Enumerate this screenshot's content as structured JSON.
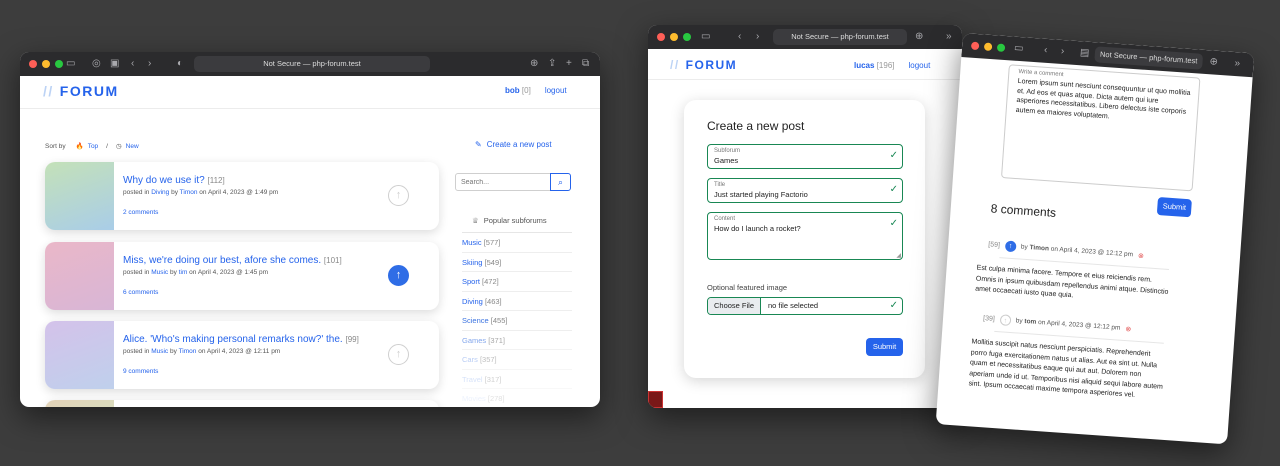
{
  "window1": {
    "address": "Not Secure — php-forum.test",
    "logo": "FORUM",
    "nav": {
      "user": "bob",
      "points": "[0]",
      "logout": "logout"
    },
    "sort": {
      "label": "Sort by",
      "top": "Top",
      "sep": "/",
      "new": "New"
    },
    "create_link": "Create a new post",
    "search_placeholder": "Search...",
    "popular_heading": "Popular subforums",
    "posts": [
      {
        "title": "Why do we use it?",
        "score": "[112]",
        "pre": "posted in",
        "forum": "Diving",
        "by": "by",
        "author": "Timon",
        "date": "on April 4, 2023 @ 1:49 pm",
        "comments": "2 comments",
        "voted": false
      },
      {
        "title": "Miss, we're doing our best, afore she comes.",
        "score": "[101]",
        "pre": "posted in",
        "forum": "Music",
        "by": "by",
        "author": "tim",
        "date": "on April 4, 2023 @ 1:45 pm",
        "comments": "6 comments",
        "voted": true
      },
      {
        "title": "Alice. 'Who's making personal remarks now?' the.",
        "score": "[99]",
        "pre": "posted in",
        "forum": "Music",
        "by": "by",
        "author": "Timon",
        "date": "on April 4, 2023 @ 12:11 pm",
        "comments": "9 comments",
        "voted": false
      }
    ],
    "subforums": [
      {
        "name": "Music",
        "count": "[577]"
      },
      {
        "name": "Skiing",
        "count": "[549]"
      },
      {
        "name": "Sport",
        "count": "[472]"
      },
      {
        "name": "Diving",
        "count": "[463]"
      },
      {
        "name": "Science",
        "count": "[455]"
      },
      {
        "name": "Games",
        "count": "[371]"
      },
      {
        "name": "Cars",
        "count": "[357]"
      },
      {
        "name": "Travel",
        "count": "[317]"
      },
      {
        "name": "Movies",
        "count": "[278]"
      }
    ]
  },
  "window2": {
    "address": "Not Secure — php-forum.test",
    "logo": "FORUM",
    "nav": {
      "user": "lucas",
      "points": "[196]",
      "logout": "logout"
    },
    "card_title": "Create a new post",
    "subforum": {
      "label": "Subforum",
      "value": "Games"
    },
    "title": {
      "label": "Title",
      "value": "Just started playing Factorio"
    },
    "content": {
      "label": "Content",
      "value": "How do I launch a rocket?"
    },
    "image_label": "Optional featured image",
    "choose_file": "Choose File",
    "no_file": "no file selected",
    "submit": "Submit"
  },
  "window3": {
    "address": "Not Secure — php-forum.test",
    "write_label": "Write a comment",
    "write_text": "Lorem ipsum sunt nesciunt consequuntur ut quo mollitia et. Ad eos et quas atque. Dicta autem qui iure asperiores necessitatibus. Libero delectus iste corporis autem ea maiores voluptatem.",
    "submit": "Submit",
    "comments_heading": "8 comments",
    "comments": [
      {
        "score": "[59]",
        "by": "by",
        "author": "Timon",
        "date": "on April 4, 2023 @ 12:12 pm",
        "voted": true,
        "body": "Est culpa minima facere. Tempore et eius reiciendis rem. Omnis in ipsum quibusdam repellendus animi atque. Distinctio amet occaecati iusto quae quia."
      },
      {
        "score": "[39]",
        "by": "by",
        "author": "tom",
        "date": "on April 4, 2023 @ 12:12 pm",
        "voted": false,
        "body": "Mollitia suscipit natus nesciunt perspiciatis. Reprehenderit porro fuga exercitationem natus ut alias. Aut ea sint ut. Nulla quam et necessitatibus eaque qui aut aut. Dolorem non aperiam unde id ut. Temporibus nisi aliquid sequi labore autem sint. Ipsum occaecati maxime tempora asperiores vel."
      }
    ]
  },
  "colors": {
    "accent": "#2563eb",
    "valid": "#198754",
    "delete": "#e25555"
  }
}
